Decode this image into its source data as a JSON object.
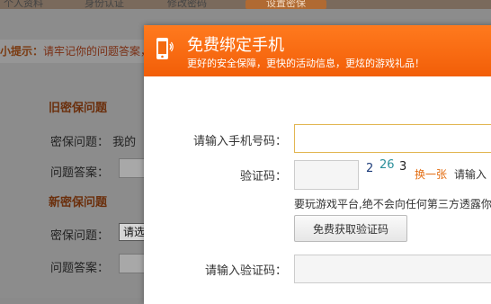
{
  "background": {
    "tabs": [
      "个人资料",
      "身份认证",
      "修改密码",
      "设置密保"
    ],
    "tip_strong": "小提示：",
    "tip_text": "请牢记你的问题答案，",
    "old_section": "旧密保问题",
    "old_question_label": "密保问题：",
    "old_question_value": "我的",
    "old_answer_label": "问题答案：",
    "new_section": "新密保问题",
    "new_question_label": "密保问题：",
    "new_question_select": "请选",
    "new_answer_label": "问题答案："
  },
  "modal": {
    "icon": "mobile-phone-icon",
    "title": "免费绑定手机",
    "subtitle": "更好的安全保障，更快的活动信息，更炫的游戏礼品！",
    "phone_label": "请输入手机号码：",
    "phone_value": "",
    "captcha_label": "验证码：",
    "captcha_value": "",
    "captcha_chars": [
      "2",
      "26",
      "3"
    ],
    "refresh_link": "换一张",
    "captcha_hint": "请输入",
    "promise_text": "要玩游戏平台,绝不会向任何第三方透露你",
    "get_code_button": "免费获取验证码",
    "sms_code_label": "请输入验证码：",
    "sms_code_value": ""
  },
  "colors": {
    "header_orange": "#f36a10",
    "link_orange": "#e36d12",
    "focus_border": "#e2b652"
  }
}
